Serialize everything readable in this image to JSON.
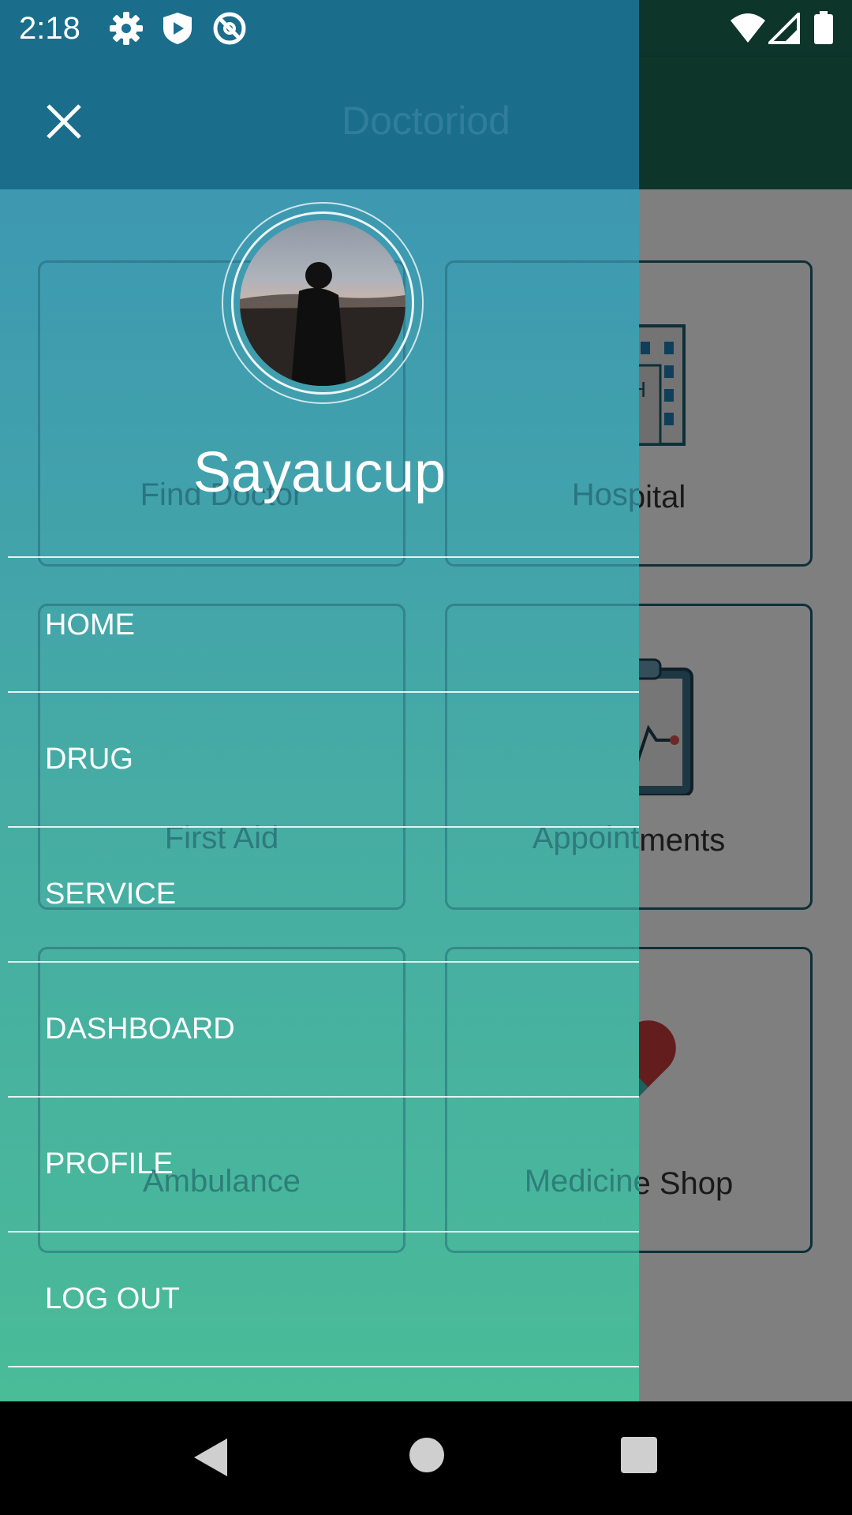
{
  "status_bar": {
    "time": "2:18"
  },
  "app_bar": {
    "title": "Doctoriod"
  },
  "drawer": {
    "user_name": "Sayaucup",
    "menu": [
      {
        "label": "HOME"
      },
      {
        "label": "DRUG"
      },
      {
        "label": "SERVICE"
      },
      {
        "label": "DASHBOARD"
      },
      {
        "label": "PROFILE"
      },
      {
        "label": "LOG OUT"
      }
    ]
  },
  "grid": {
    "cards": [
      {
        "label": "Find Doctor"
      },
      {
        "label": "Hospital"
      },
      {
        "label": "First Aid"
      },
      {
        "label": "Appointments"
      },
      {
        "label": "Ambulance"
      },
      {
        "label": "Medicine Shop"
      }
    ]
  },
  "colors": {
    "app_bar": "#1b6a55",
    "drawer_top": "#1c7094",
    "drawer_bottom": "#47bb94",
    "card_border": "#1c5f73"
  },
  "icons": {
    "close": "close-icon",
    "settings": "gear-icon",
    "shield": "shield-icon",
    "sync_off": "sync-off-icon",
    "wifi": "wifi-icon",
    "signal": "signal-icon",
    "battery": "battery-icon",
    "back": "back-icon",
    "home": "home-circle-icon",
    "recents": "recents-icon"
  }
}
